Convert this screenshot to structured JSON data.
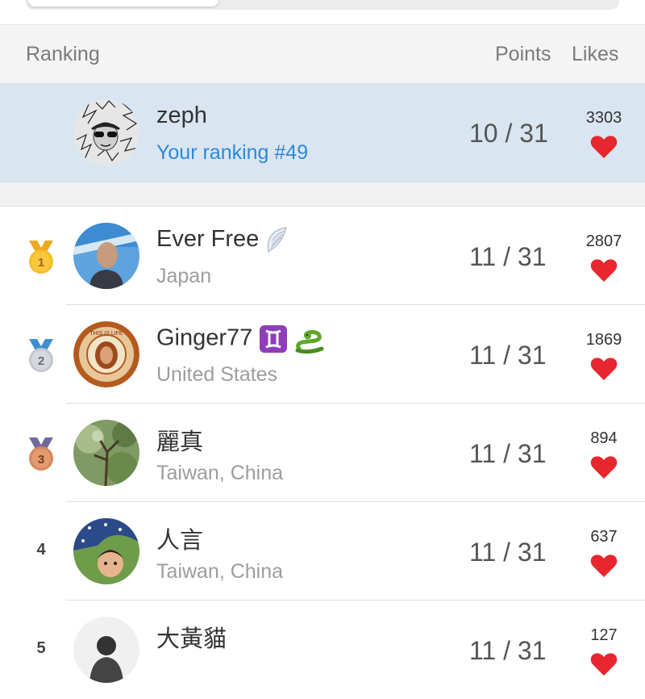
{
  "header": {
    "ranking_label": "Ranking",
    "points_label": "Points",
    "likes_label": "Likes"
  },
  "me": {
    "name": "zeph",
    "ranking_text": "Your ranking #49",
    "points": "10 / 31",
    "likes": "3303"
  },
  "rows": [
    {
      "rank": "1",
      "name": "Ever Free",
      "location": "Japan",
      "points": "11 / 31",
      "likes": "2807",
      "badge_icon": "angel-wing-icon"
    },
    {
      "rank": "2",
      "name": "Ginger77",
      "location": "United States",
      "points": "11 / 31",
      "likes": "1869",
      "badge_icon": "gemini-icon snake-icon"
    },
    {
      "rank": "3",
      "name": "麗真",
      "location": "Taiwan, China",
      "points": "11 / 31",
      "likes": "894"
    },
    {
      "rank": "4",
      "name": "人言",
      "location": "Taiwan, China",
      "points": "11 / 31",
      "likes": "637"
    },
    {
      "rank": "5",
      "name": "大黃貓",
      "location": "",
      "points": "11 / 31",
      "likes": "127"
    }
  ],
  "colors": {
    "highlight_row": "#d9e5f1",
    "accent_blue": "#2f88d9",
    "heart_red": "#e8262d",
    "gold": "#f3b52b",
    "silver": "#c9ccd0",
    "bronze": "#d98a5c"
  }
}
